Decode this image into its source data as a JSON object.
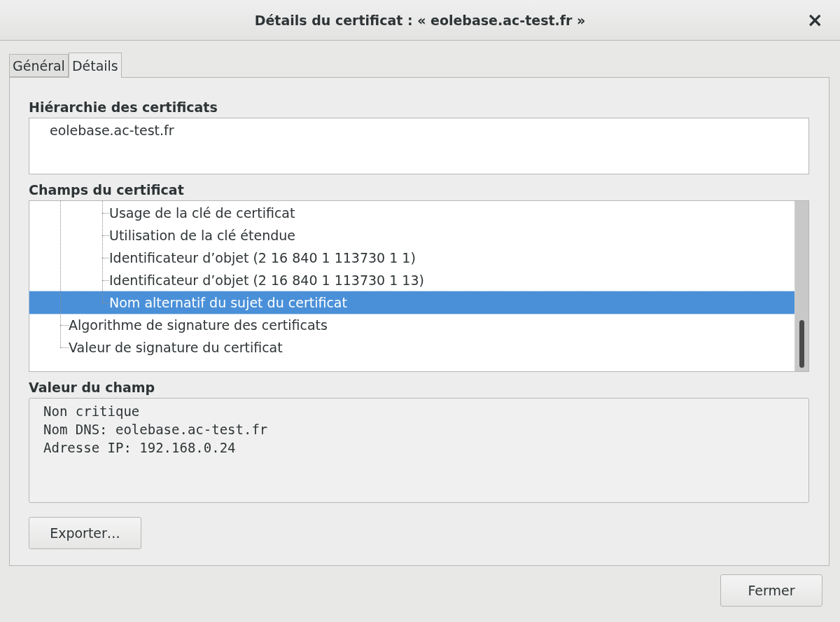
{
  "window": {
    "title": "Détails du certificat : « eolebase.ac-test.fr »",
    "close": "×"
  },
  "tabs": [
    {
      "label": "Général",
      "selected": false
    },
    {
      "label": "Détails",
      "selected": true
    }
  ],
  "hierarchy": {
    "heading": "Hiérarchie des certificats",
    "items": [
      {
        "label": "eolebase.ac-test.fr"
      }
    ]
  },
  "fields": {
    "heading": "Champs du certificat",
    "items": [
      {
        "children": [
          {
            "label": "Usage de la clé de certificat",
            "selected": false
          },
          {
            "label": "Utilisation de la clé étendue",
            "selected": false
          },
          {
            "label": "Identificateur d’objet (2 16 840 1 113730 1 1)",
            "selected": false
          },
          {
            "label": "Identificateur d’objet (2 16 840 1 113730 1 13)",
            "selected": false
          },
          {
            "label": "Nom alternatif du sujet du certificat",
            "selected": true
          }
        ]
      },
      {
        "label": "Algorithme de signature des certificats",
        "selected": false
      },
      {
        "label": "Valeur de signature du certificat",
        "selected": false
      }
    ]
  },
  "value": {
    "heading": "Valeur du champ",
    "lines": [
      "Non critique",
      "Nom DNS: eolebase.ac-test.fr",
      "Adresse IP: 192.168.0.24"
    ]
  },
  "buttons": {
    "export": "Exporter…",
    "close": "Fermer"
  }
}
